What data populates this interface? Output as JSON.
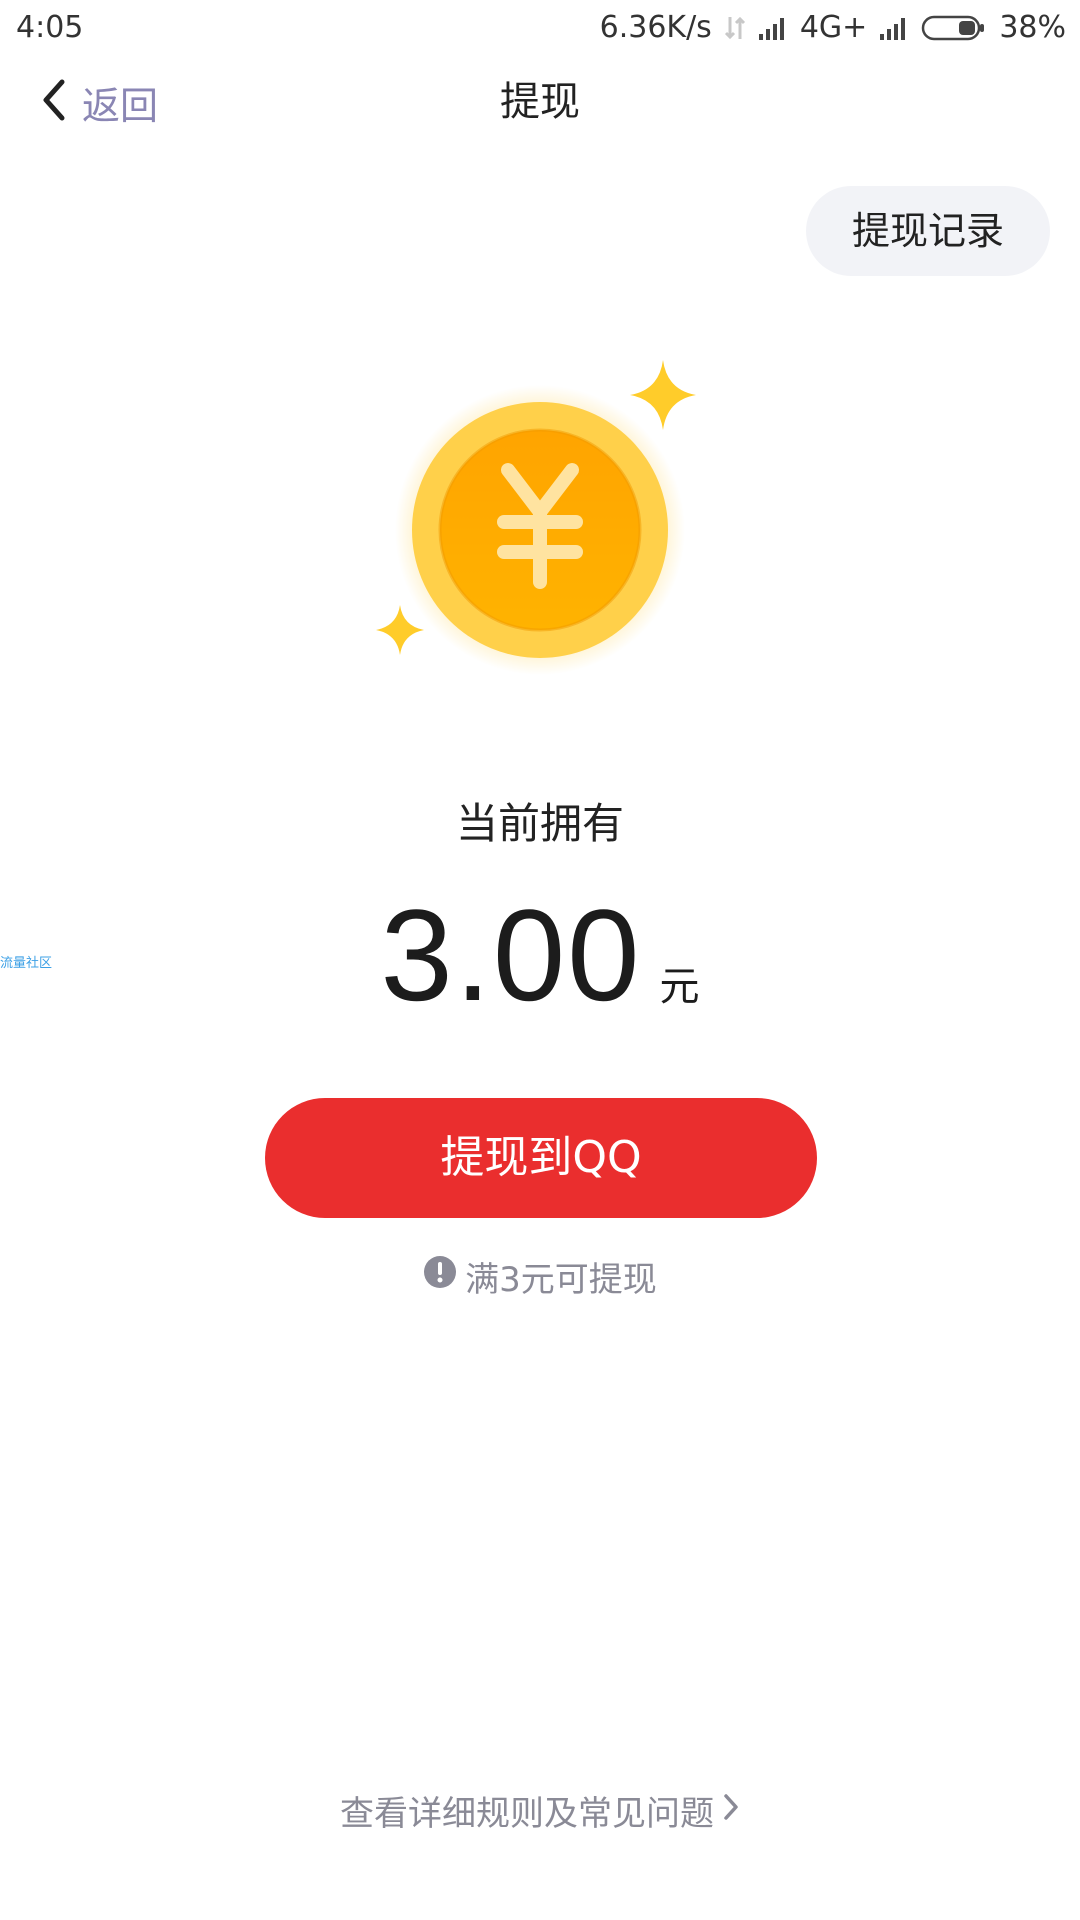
{
  "status_bar": {
    "time": "4:05",
    "network_speed": "6.36K/s",
    "network_type": "4G+",
    "battery": "38%"
  },
  "nav": {
    "back_label": "返回",
    "title": "提现"
  },
  "record_button": {
    "label": "提现记录"
  },
  "balance": {
    "label": "当前拥有",
    "amount": "3.00",
    "unit": "元"
  },
  "withdraw_button": {
    "label": "提现到QQ"
  },
  "hint": {
    "text": "满3元可提现"
  },
  "rules_link": {
    "text": "查看详细规则及常见问题"
  },
  "watermark": {
    "text": "流量社区"
  },
  "colors": {
    "accent_red": "#ea2e2e",
    "back_label": "#8a86b4",
    "coin_gold": "#ffb300",
    "hint_gray": "#8a8a96"
  },
  "icons": {
    "back": "chevron-left-icon",
    "coin": "yuan-coin-icon",
    "sparkle": "sparkle-icon",
    "info": "exclamation-circle-icon",
    "rules_arrow": "chevron-right-icon"
  }
}
